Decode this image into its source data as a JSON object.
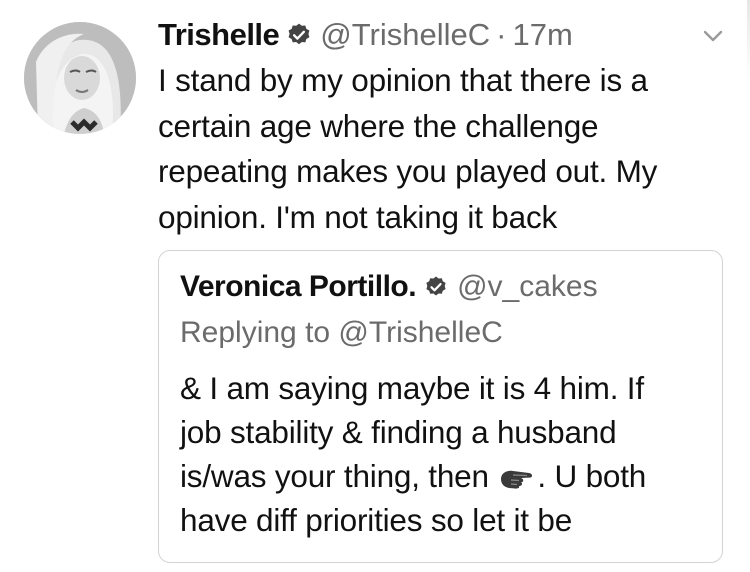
{
  "tweet": {
    "display_name": "Trishelle",
    "handle": "@TrishelleC",
    "separator": "·",
    "time": "17m",
    "text": "I stand by my opinion that there is a certain age where the challenge repeating makes you played out. My opinion. I'm not taking it back",
    "icons": {
      "avatar": "profile-photo",
      "verified": "verified-badge-icon",
      "menu": "chevron-down-icon"
    }
  },
  "quoted_tweet": {
    "display_name": "Veronica Portillo.",
    "handle": "@v_cakes",
    "reply_context": "Replying to @TrishelleC",
    "text_line1": "& I am saying maybe it is 4 him. If",
    "text_line2": "job stability & finding a husband",
    "text_line3_before_emoji": "is/was your thing, then ",
    "text_line3_after_emoji": ". U both",
    "text_line4": "have diff priorities so let it be",
    "emoji": "pointing-hand-emoji"
  },
  "colors": {
    "text": "#111111",
    "secondary": "#6b6b6b",
    "border": "#d3d3d3",
    "background": "#ffffff"
  }
}
